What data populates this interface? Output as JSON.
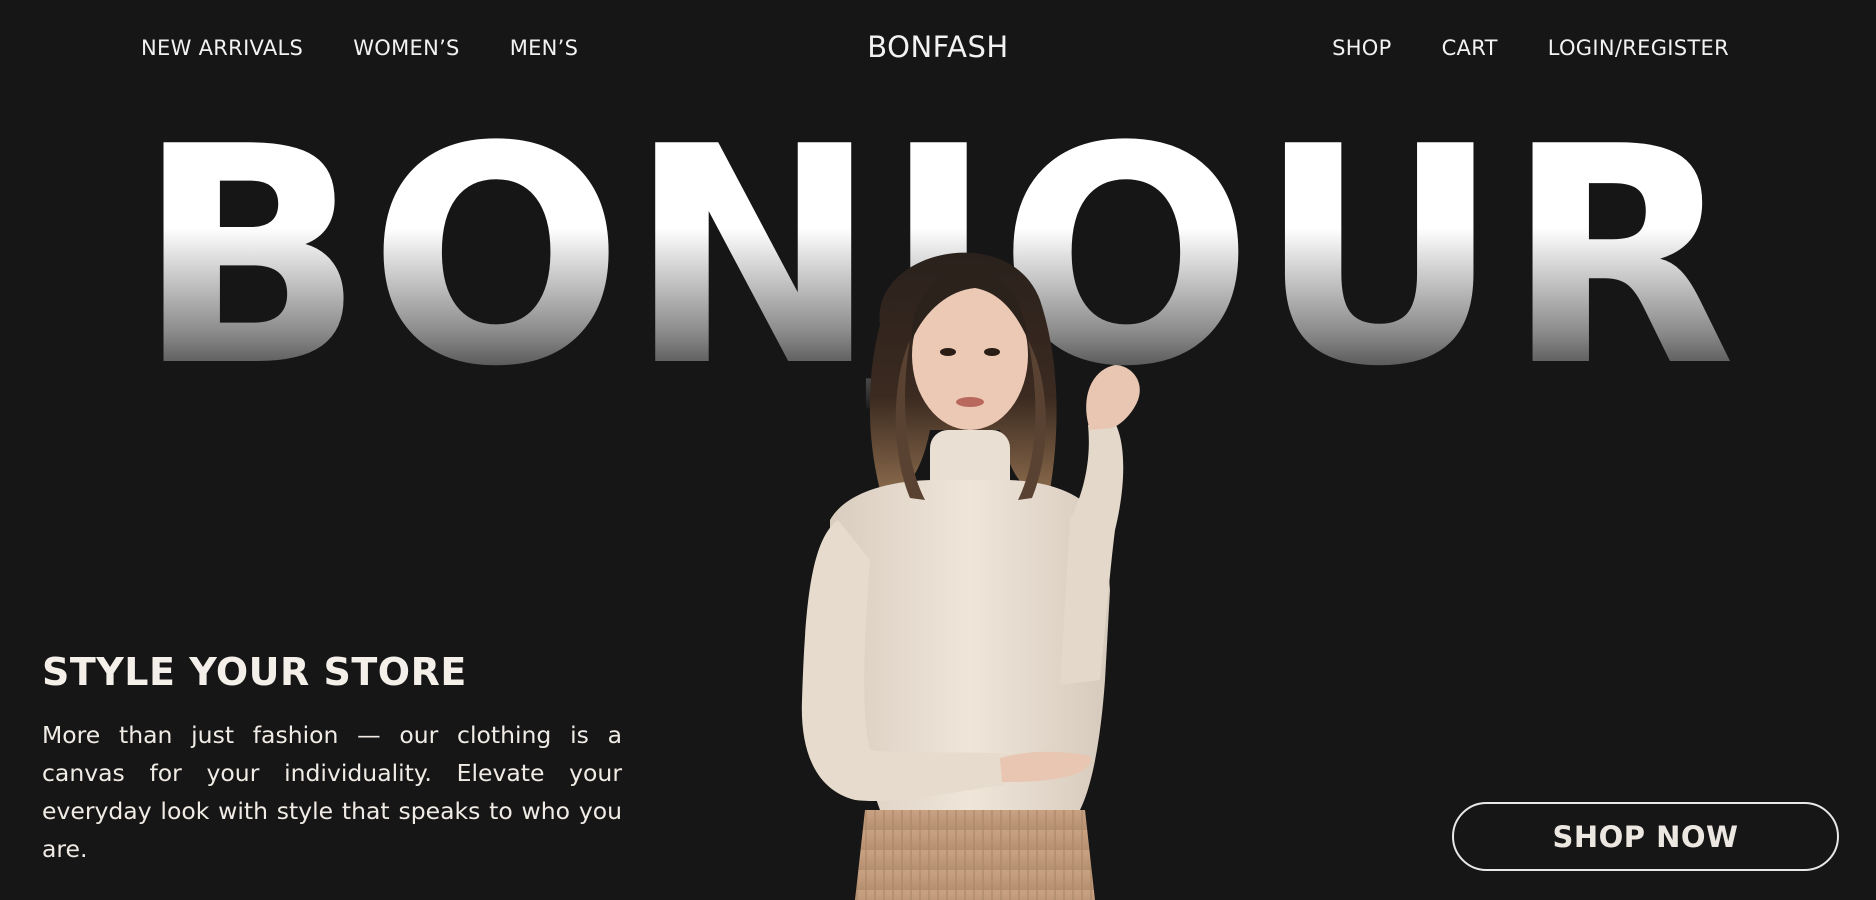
{
  "nav": {
    "left": [
      "NEW ARRIVALS",
      "WOMEN’S",
      "MEN’S"
    ],
    "brand": "BONFASH",
    "right": [
      "SHOP",
      "CART",
      "LOGIN/REGISTER"
    ]
  },
  "hero": {
    "word": "BONJOUR",
    "image": "woman-in-turtleneck-photo"
  },
  "promo": {
    "title": "STYLE YOUR STORE",
    "text": "More than just fashion — our clothing is a canvas for your individuality. Elevate your everyday look with style that speaks to who you are."
  },
  "cta": {
    "label": "SHOP NOW"
  },
  "colors": {
    "background": "#161616",
    "text": "#f2f2f2",
    "sweater": "#ece1d4",
    "skirt": "#c9a282"
  }
}
